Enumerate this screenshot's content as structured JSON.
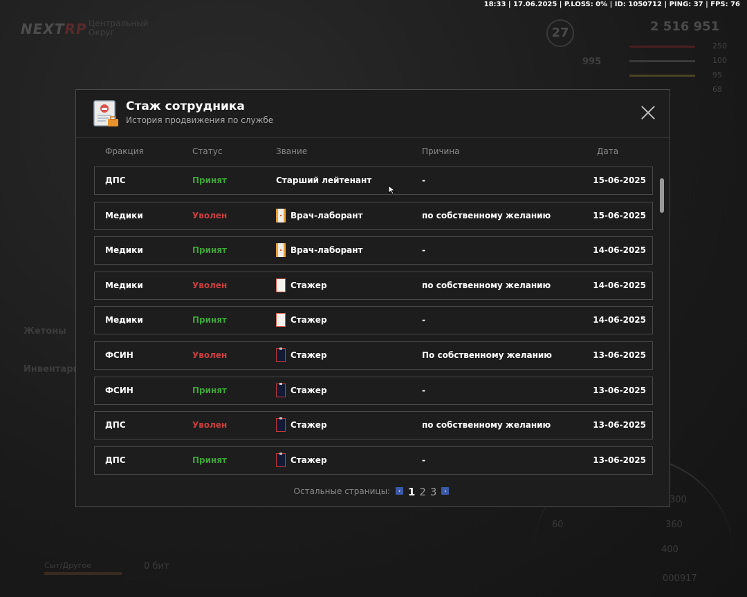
{
  "status_line": "18:33 | 17.06.2025 | P.LOSS: 0% | ID: 1050712 | PING: 37 | FPS: 76",
  "hud": {
    "logo": "NEXT",
    "logo_accent": "RP",
    "city_line1": "Центральный",
    "city_line2": "Округ",
    "level": "27",
    "money": "2 516 951",
    "stats": [
      "250",
      "100",
      "95",
      "68"
    ],
    "mid_value": "995",
    "side_tokens": "Жетоны",
    "side_inventory": "Инвентарь",
    "speed_ticks": [
      "60",
      "300",
      "360",
      "400"
    ],
    "hunger_label": "Сыт/Другое",
    "bits_label": "0 бит",
    "odometer": "000917"
  },
  "modal": {
    "title": "Стаж сотрудника",
    "subtitle": "История продвижения по службе",
    "icon": "employee-document-icon",
    "close_icon": "close-icon",
    "columns": {
      "faction": "Фракция",
      "status": "Статус",
      "rank": "Звание",
      "reason": "Причина",
      "date": "Дата"
    },
    "rows": [
      {
        "faction": "ДПС",
        "status": "Принят",
        "status_type": "hired",
        "rank": "Старший лейтенант",
        "rank_icon": "",
        "reason": "-",
        "date": "15-06-2025"
      },
      {
        "faction": "Медики",
        "status": "Уволен",
        "status_type": "fired",
        "rank": "Врач-лаборант",
        "rank_icon": "lab-badge-icon",
        "reason": "по собственному желанию",
        "date": "15-06-2025"
      },
      {
        "faction": "Медики",
        "status": "Принят",
        "status_type": "hired",
        "rank": "Врач-лаборант",
        "rank_icon": "lab-badge-icon",
        "reason": "-",
        "date": "14-06-2025"
      },
      {
        "faction": "Медики",
        "status": "Уволен",
        "status_type": "fired",
        "rank": "Стажер",
        "rank_icon": "intern-badge-icon",
        "reason": "по собственному желанию",
        "date": "14-06-2025"
      },
      {
        "faction": "Медики",
        "status": "Принят",
        "status_type": "hired",
        "rank": "Стажер",
        "rank_icon": "intern-badge-icon",
        "reason": "-",
        "date": "14-06-2025"
      },
      {
        "faction": "ФСИН",
        "status": "Уволен",
        "status_type": "fired",
        "rank": "Стажер",
        "rank_icon": "fsin-badge-icon",
        "reason": "По собственному желанию",
        "date": "13-06-2025"
      },
      {
        "faction": "ФСИН",
        "status": "Принят",
        "status_type": "hired",
        "rank": "Стажер",
        "rank_icon": "fsin-badge-icon",
        "reason": "-",
        "date": "13-06-2025"
      },
      {
        "faction": "ДПС",
        "status": "Уволен",
        "status_type": "fired",
        "rank": "Стажер",
        "rank_icon": "fsin-badge-icon",
        "reason": "по собственному желанию",
        "date": "13-06-2025"
      },
      {
        "faction": "ДПС",
        "status": "Принят",
        "status_type": "hired",
        "rank": "Стажер",
        "rank_icon": "fsin-badge-icon",
        "reason": "-",
        "date": "13-06-2025"
      }
    ],
    "pager": {
      "label": "Остальные страницы:",
      "prev_icon": "chevron-left-icon",
      "next_icon": "chevron-right-icon",
      "pages": [
        "1",
        "2",
        "3"
      ],
      "active_page": "1"
    }
  },
  "colors": {
    "hired": "#3fa33a",
    "fired": "#c84040",
    "accent_blue": "#3b5aa6"
  }
}
